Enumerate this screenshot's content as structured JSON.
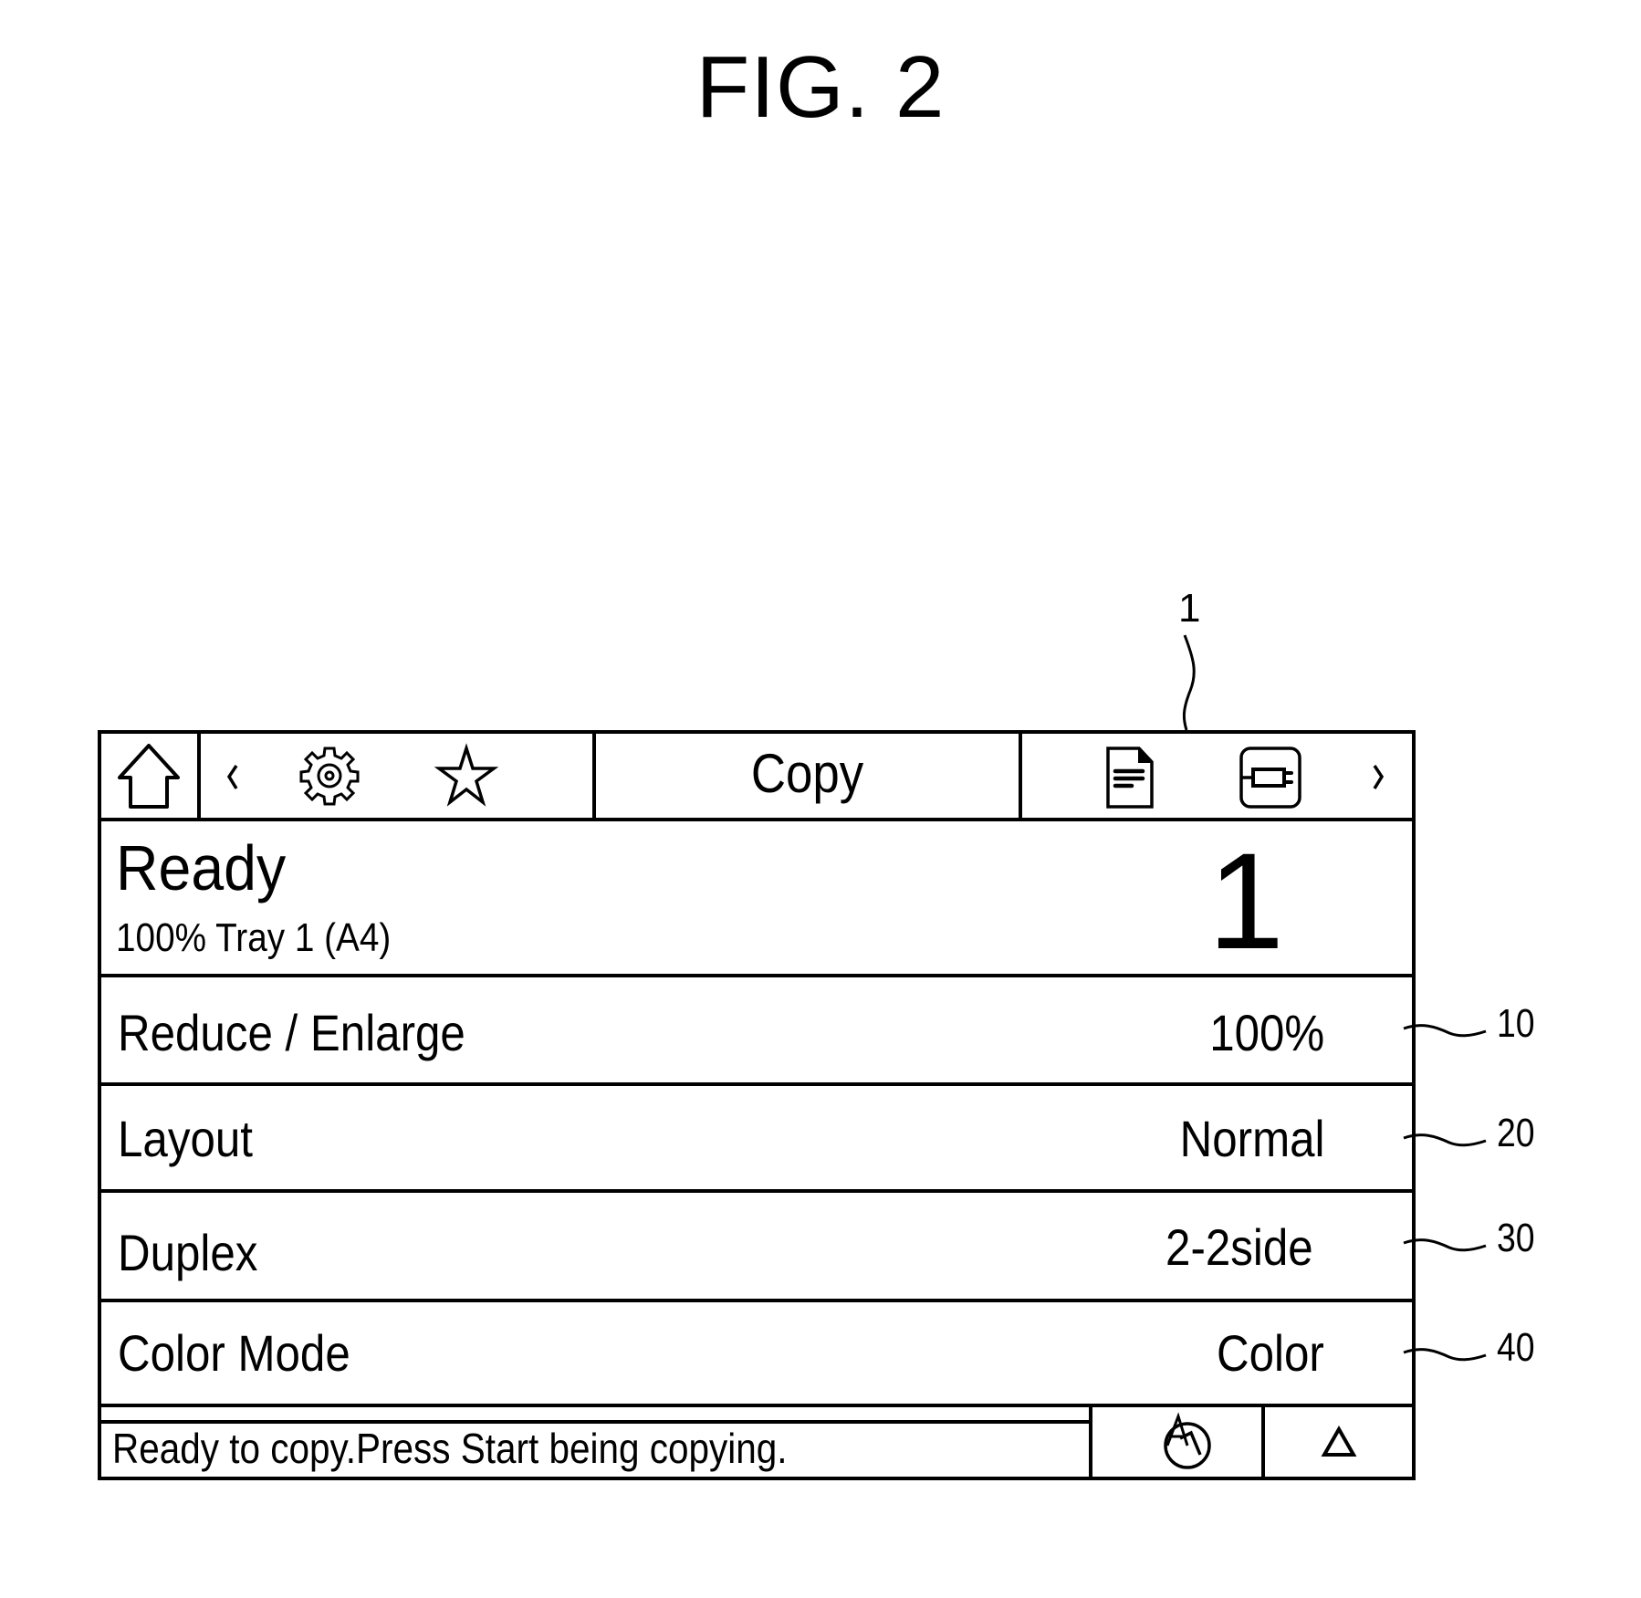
{
  "figure": {
    "title": "FIG. 2",
    "reference_numeral": "1"
  },
  "toolbar": {
    "home_icon": "home-icon",
    "prev_icon": "chevron-left-icon",
    "settings_icon": "gear-icon",
    "favorite_icon": "star-icon",
    "title": "Copy",
    "document_icon": "document-icon",
    "device_icon": "connector-icon",
    "next_icon": "chevron-right-icon"
  },
  "status_panel": {
    "state": "Ready",
    "details": "100% Tray 1 (A4)",
    "copies": "1"
  },
  "settings": [
    {
      "label": "Reduce / Enlarge",
      "value": "100%",
      "ref": "10"
    },
    {
      "label": "Layout",
      "value": "Normal",
      "ref": "20"
    },
    {
      "label": "Duplex",
      "value": "2-2side",
      "ref": "30"
    },
    {
      "label": "Color Mode",
      "value": "Color",
      "ref": "40"
    }
  ],
  "status_bar": {
    "message": "Ready to copy.Press Start being copying.",
    "reset_icon": "reset-icon",
    "expand_icon": "triangle-up-icon"
  }
}
